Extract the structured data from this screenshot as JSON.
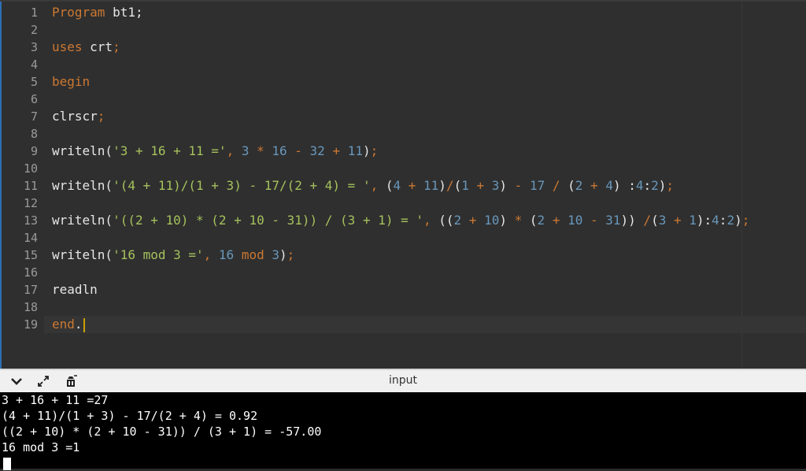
{
  "editor": {
    "line_numbers": [
      "1",
      "2",
      "3",
      "4",
      "5",
      "6",
      "7",
      "8",
      "9",
      "10",
      "11",
      "12",
      "13",
      "14",
      "15",
      "16",
      "17",
      "18",
      "19"
    ],
    "lines": [
      [
        {
          "t": "kw",
          "v": "Program"
        },
        {
          "t": "id",
          "v": " bt1;"
        }
      ],
      [],
      [
        {
          "t": "kw",
          "v": "uses"
        },
        {
          "t": "id",
          "v": " crt"
        },
        {
          "t": "kw",
          "v": ";"
        }
      ],
      [],
      [
        {
          "t": "kw",
          "v": "begin"
        }
      ],
      [],
      [
        {
          "t": "id",
          "v": "clrscr"
        },
        {
          "t": "kw",
          "v": ";"
        }
      ],
      [],
      [
        {
          "t": "id",
          "v": "writeln("
        },
        {
          "t": "str",
          "v": "'3 + 16 + 11 ='"
        },
        {
          "t": "kw",
          "v": ", "
        },
        {
          "t": "num",
          "v": "3"
        },
        {
          "t": "kw",
          "v": " * "
        },
        {
          "t": "num",
          "v": "16"
        },
        {
          "t": "kw",
          "v": " - "
        },
        {
          "t": "num",
          "v": "32"
        },
        {
          "t": "kw",
          "v": " + "
        },
        {
          "t": "num",
          "v": "11"
        },
        {
          "t": "id",
          "v": ")"
        },
        {
          "t": "kw",
          "v": ";"
        }
      ],
      [],
      [
        {
          "t": "id",
          "v": "writeln("
        },
        {
          "t": "str",
          "v": "'(4 + 11)/(1 + 3) - 17/(2 + 4) = '"
        },
        {
          "t": "kw",
          "v": ", "
        },
        {
          "t": "id",
          "v": "("
        },
        {
          "t": "num",
          "v": "4"
        },
        {
          "t": "kw",
          "v": " + "
        },
        {
          "t": "num",
          "v": "11"
        },
        {
          "t": "id",
          "v": ")"
        },
        {
          "t": "kw",
          "v": "/"
        },
        {
          "t": "id",
          "v": "("
        },
        {
          "t": "num",
          "v": "1"
        },
        {
          "t": "kw",
          "v": " + "
        },
        {
          "t": "num",
          "v": "3"
        },
        {
          "t": "id",
          "v": ")"
        },
        {
          "t": "kw",
          "v": " - "
        },
        {
          "t": "num",
          "v": "17"
        },
        {
          "t": "kw",
          "v": " / "
        },
        {
          "t": "id",
          "v": "("
        },
        {
          "t": "num",
          "v": "2"
        },
        {
          "t": "kw",
          "v": " + "
        },
        {
          "t": "num",
          "v": "4"
        },
        {
          "t": "id",
          "v": ")"
        },
        {
          "t": "id",
          "v": " :"
        },
        {
          "t": "num",
          "v": "4"
        },
        {
          "t": "id",
          "v": ":"
        },
        {
          "t": "num",
          "v": "2"
        },
        {
          "t": "id",
          "v": ")"
        },
        {
          "t": "kw",
          "v": ";"
        }
      ],
      [],
      [
        {
          "t": "id",
          "v": "writeln("
        },
        {
          "t": "str",
          "v": "'((2 + 10) * (2 + 10 - 31)) / (3 + 1) = '"
        },
        {
          "t": "kw",
          "v": ", "
        },
        {
          "t": "id",
          "v": "(("
        },
        {
          "t": "num",
          "v": "2"
        },
        {
          "t": "kw",
          "v": " + "
        },
        {
          "t": "num",
          "v": "10"
        },
        {
          "t": "id",
          "v": ")"
        },
        {
          "t": "kw",
          "v": " * "
        },
        {
          "t": "id",
          "v": "("
        },
        {
          "t": "num",
          "v": "2"
        },
        {
          "t": "kw",
          "v": " + "
        },
        {
          "t": "num",
          "v": "10"
        },
        {
          "t": "kw",
          "v": " - "
        },
        {
          "t": "num",
          "v": "31"
        },
        {
          "t": "id",
          "v": "))"
        },
        {
          "t": "kw",
          "v": " /"
        },
        {
          "t": "id",
          "v": "("
        },
        {
          "t": "num",
          "v": "3"
        },
        {
          "t": "kw",
          "v": " + "
        },
        {
          "t": "num",
          "v": "1"
        },
        {
          "t": "id",
          "v": "):"
        },
        {
          "t": "num",
          "v": "4"
        },
        {
          "t": "id",
          "v": ":"
        },
        {
          "t": "num",
          "v": "2"
        },
        {
          "t": "id",
          "v": ")"
        },
        {
          "t": "kw",
          "v": ";"
        }
      ],
      [],
      [
        {
          "t": "id",
          "v": "writeln("
        },
        {
          "t": "str",
          "v": "'16 mod 3 ='"
        },
        {
          "t": "kw",
          "v": ", "
        },
        {
          "t": "num",
          "v": "16"
        },
        {
          "t": "kw",
          "v": " mod "
        },
        {
          "t": "num",
          "v": "3"
        },
        {
          "t": "id",
          "v": ")"
        },
        {
          "t": "kw",
          "v": ";"
        }
      ],
      [],
      [
        {
          "t": "id",
          "v": "readln"
        }
      ],
      [],
      [
        {
          "t": "kw",
          "v": "end"
        },
        {
          "t": "id",
          "v": "."
        }
      ]
    ],
    "active_line": 19
  },
  "toolbar": {
    "label": "input",
    "icons": [
      "chevron-down-icon",
      "expand-icon",
      "clear-console-icon"
    ]
  },
  "console": {
    "output": [
      "3 + 16 + 11 =27",
      "(4 + 11)/(1 + 3) - 17/(2 + 4) = 0.92",
      "((2 + 10) * (2 + 10 - 31)) / (3 + 1) = -57.00",
      "16 mod 3 =1"
    ]
  },
  "colors": {
    "keyword": "#cc7832",
    "string": "#a5c25c",
    "number": "#6897bb",
    "text": "#e6e6e6",
    "editor_bg": "#2f2f2f",
    "console_bg": "#000000"
  }
}
